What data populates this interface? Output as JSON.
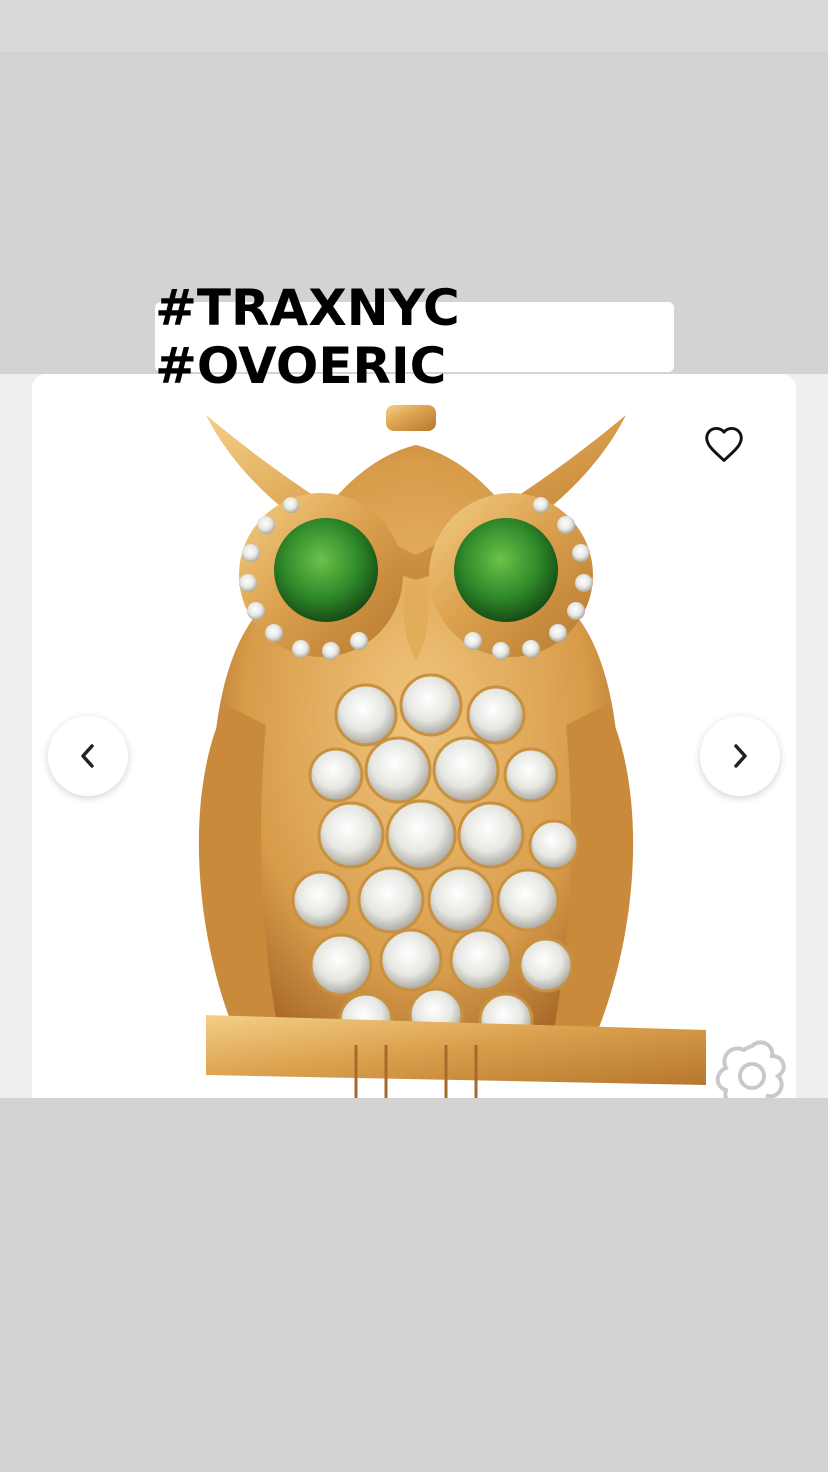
{
  "story": {
    "hashtag_text": "#TRAXNYC #OVOERIC"
  },
  "product_card": {
    "image_subject": "gold owl pendant with diamonds and green gemstone eyes",
    "favorite_icon": "heart-outline-icon",
    "prev_icon": "chevron-left-icon",
    "next_icon": "chevron-right-icon",
    "watermark_icon": "brand-logo-watermark"
  },
  "colors": {
    "background": "#d3d3d3",
    "card": "#ffffff",
    "gold": "#d9a44e",
    "emerald": "#2f8a2a"
  }
}
